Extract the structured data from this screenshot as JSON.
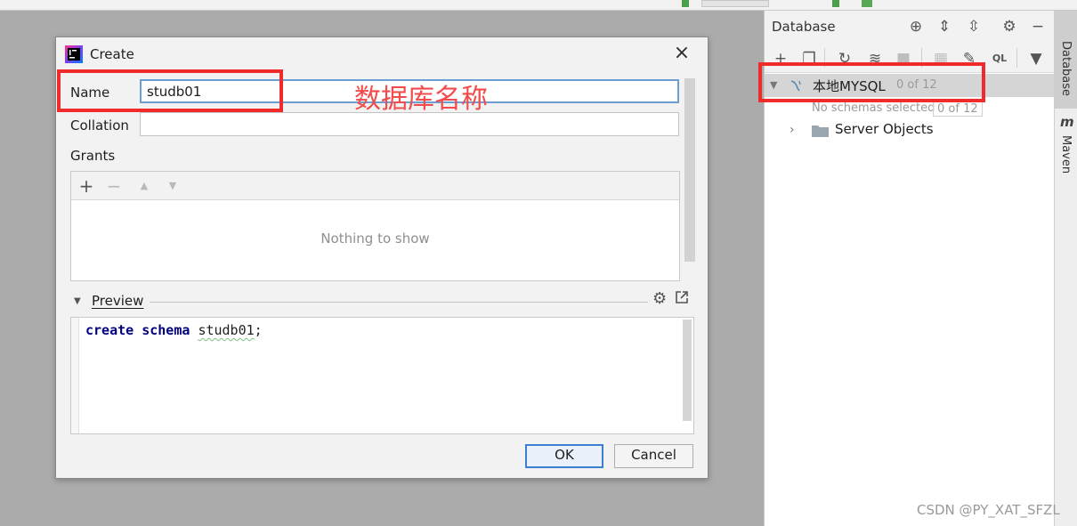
{
  "dialog": {
    "title": "Create",
    "name_label": "Name",
    "name_value": "studb01",
    "collation_label": "Collation",
    "collation_value": "",
    "grants_label": "Grants",
    "grants_empty": "Nothing to show",
    "preview_label": "Preview",
    "code": {
      "kw1": "create",
      "kw2": "schema",
      "ident": "studb01",
      "end": ";"
    },
    "ok_label": "OK",
    "cancel_label": "Cancel"
  },
  "annotation": {
    "text": "数据库名称",
    "color": "#f02b2b"
  },
  "database_panel": {
    "title": "Database",
    "connection_name": "本地MYSQL",
    "connection_count": "0 of 12",
    "schemas_status": "No schemas selected",
    "schemas_count": "0 of 12",
    "server_objects": "Server Objects"
  },
  "side_tabs": {
    "database": "Database",
    "maven": "Maven"
  },
  "watermark": "CSDN @PY_XAT_SFZL"
}
